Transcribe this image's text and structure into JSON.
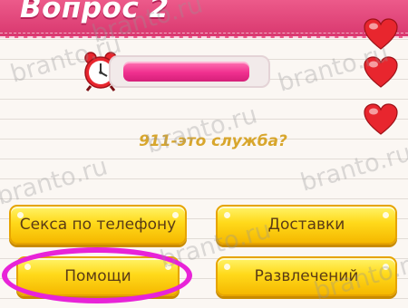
{
  "header": {
    "title": "Вопрос 2"
  },
  "timer": {
    "remaining_fraction": 0.9
  },
  "lives": {
    "count": 3
  },
  "question": {
    "text": "911-это служба?"
  },
  "answers": [
    {
      "label": "Секса по телефону"
    },
    {
      "label": "Доставки"
    },
    {
      "label": "Помощи",
      "highlighted": true
    },
    {
      "label": "Развлечений"
    }
  ],
  "watermark": {
    "text": "branto.ru"
  },
  "colors": {
    "header": "#e04a7c",
    "timer_fill": "#f0308f",
    "button": "#ffd91a",
    "question_text": "#d8a62c",
    "highlight_ring": "#e823d8",
    "heart": "#e8262e"
  }
}
